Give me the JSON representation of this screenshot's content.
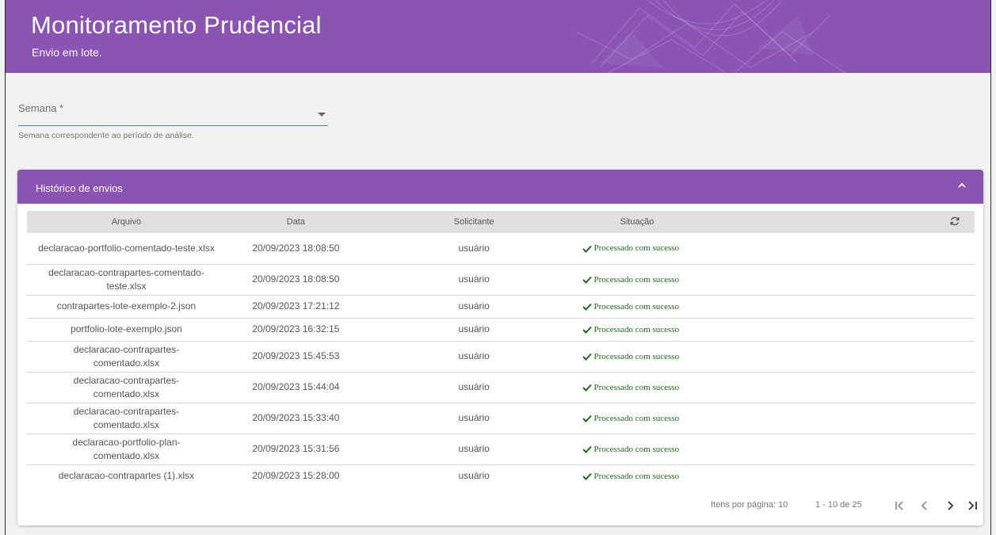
{
  "header": {
    "title": "Monitoramento Prudencial",
    "subtitle": "Envio em lote."
  },
  "week_field": {
    "label": "Semana *",
    "value": "",
    "hint": "Semana correspondente ao período de análise."
  },
  "history": {
    "title": "Histórico de envios",
    "columns": [
      "Arquivo",
      "Data",
      "Solicitante",
      "Situação"
    ],
    "rows": [
      {
        "file": "declaracao-portfolio-comentado-teste.xlsx",
        "date": "20/09/2023 18:08:50",
        "requester": "usuário",
        "status": "Processado com sucesso"
      },
      {
        "file": "declaracao-contrapartes-comentado-teste.xlsx",
        "date": "20/09/2023 18:08:50",
        "requester": "usuário",
        "status": "Processado com sucesso"
      },
      {
        "file": "contrapartes-lote-exemplo-2.json",
        "date": "20/09/2023 17:21:12",
        "requester": "usuário",
        "status": "Processado com sucesso"
      },
      {
        "file": "portfolio-lote-exemplo.json",
        "date": "20/09/2023 16:32:15",
        "requester": "usuário",
        "status": "Processado com sucesso"
      },
      {
        "file": "declaracao-contrapartes-comentado.xlsx",
        "date": "20/09/2023 15:45:53",
        "requester": "usuário",
        "status": "Processado com sucesso"
      },
      {
        "file": "declaracao-contrapartes-comentado.xlsx",
        "date": "20/09/2023 15:44:04",
        "requester": "usuário",
        "status": "Processado com sucesso"
      },
      {
        "file": "declaracao-contrapartes-comentado.xlsx",
        "date": "20/09/2023 15:33:40",
        "requester": "usuário",
        "status": "Processado com sucesso"
      },
      {
        "file": "declaracao-portfolio-plan-comentado.xlsx",
        "date": "20/09/2023 15:31:56",
        "requester": "usuário",
        "status": "Processado com sucesso"
      },
      {
        "file": "declaracao-contrapartes (1).xlsx",
        "date": "20/09/2023 15:28:00",
        "requester": "usuário",
        "status": "Processado com sucesso"
      }
    ],
    "pagination": {
      "items_per_page": "Itens por página: 10",
      "range": "1 - 10 de 25"
    }
  },
  "colors": {
    "brand": "#8a53b4",
    "success": "#1e6b1e",
    "field_underline": "#4a7fc1"
  },
  "icons": [
    "dropdown-caret-icon",
    "chevron-up-icon",
    "refresh-icon",
    "checkmark-icon",
    "first-page-icon",
    "previous-page-icon",
    "next-page-icon",
    "last-page-icon"
  ]
}
